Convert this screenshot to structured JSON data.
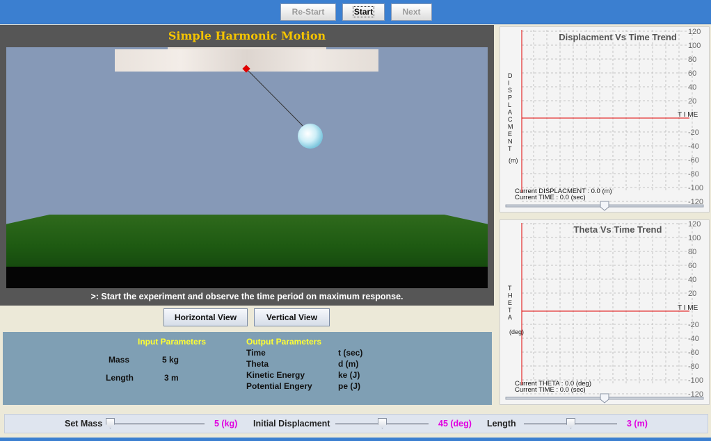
{
  "toolbar": {
    "restart_label": "Re-Start",
    "start_label": "Start",
    "next_label": "Next"
  },
  "simulation": {
    "title": "Simple Harmonic Motion",
    "instruction": ">: Start the experiment and observe the time period on maximum response.",
    "horizontal_view_label": "Horizontal View",
    "vertical_view_label": "Vertical View",
    "colors": {
      "title": "#f5c400",
      "sky": "#8699b7",
      "ground": "#1e5a12",
      "pivot": "#e00000"
    }
  },
  "input_parameters": {
    "heading": "Input  Parameters",
    "rows": [
      {
        "label": "Mass",
        "value": "5 kg"
      },
      {
        "label": "Length",
        "value": "3 m"
      }
    ]
  },
  "output_parameters": {
    "heading": "Output  Parameters",
    "rows": [
      {
        "label": "Time",
        "value": "t (sec)"
      },
      {
        "label": "Theta",
        "value": "d (m)"
      },
      {
        "label": "Kinetic Energy",
        "value": "ke (J)"
      },
      {
        "label": "Potential Engery",
        "value": "pe (J)"
      }
    ]
  },
  "displacement_graph": {
    "title": "Displacment Vs Time Trend",
    "ylabel_letters": [
      "D",
      "I",
      "S",
      "P",
      "L",
      "A",
      "C",
      "M",
      "E",
      "N",
      "T"
    ],
    "unit": "(m)",
    "xlabel": "T I ME",
    "tick_labels": [
      "120",
      "100",
      "80",
      "60",
      "40",
      "20",
      "-20",
      "-40",
      "-60",
      "-80",
      "-100",
      "-120"
    ],
    "status_line1": "Current   DISPLACMENT   : 0.0  (m)",
    "status_line2": "Current   TIME    : 0.0 (sec)",
    "slider_value": 0.5
  },
  "theta_graph": {
    "title": "Theta Vs Time Trend",
    "ylabel_letters": [
      "T",
      "H",
      "E",
      "T",
      "A"
    ],
    "unit": "(deg)",
    "xlabel": "T I ME",
    "tick_labels": [
      "120",
      "100",
      "80",
      "60",
      "40",
      "20",
      "-20",
      "-40",
      "-60",
      "-80",
      "-100",
      "-120"
    ],
    "status_line1": "Current   THETA   : 0.0  (deg)",
    "status_line2": "Current   TIME   : 0.0 (sec)",
    "slider_value": 0.5
  },
  "controls": {
    "mass": {
      "label": "Set Mass",
      "value": "5 (kg)",
      "level": 0.0
    },
    "displacement": {
      "label": "Initial Displacment",
      "value": "45 (deg)",
      "level": 0.5
    },
    "length": {
      "label": "Length",
      "value": "3 (m)",
      "level": 0.5
    },
    "value_color": "#e000e0"
  }
}
